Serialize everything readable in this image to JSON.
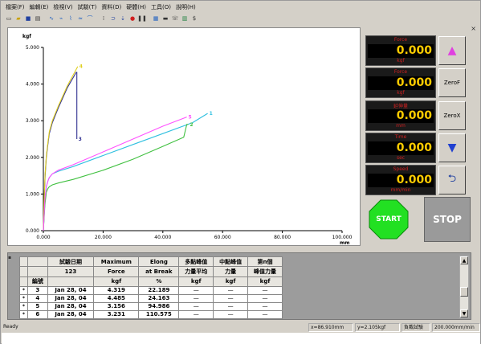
{
  "menu": [
    "檔案(F)",
    "編輯(E)",
    "檢視(V)",
    "試驗(T)",
    "資料(D)",
    "硬體(H)",
    "工具(O)",
    "說明(H)"
  ],
  "toolbar": {
    "icons": [
      "new-icon",
      "open-icon",
      "save-icon",
      "print-icon",
      "sep",
      "curve-icon",
      "chart-icon",
      "chart2-icon",
      "chart3-icon",
      "chart4-icon",
      "sep",
      "cursor-icon",
      "loop-icon",
      "down-icon",
      "stop-icon",
      "pause-icon",
      "sep",
      "table-icon",
      "grid-icon",
      "phone-icon",
      "bars-icon",
      "dollar-icon"
    ]
  },
  "chart_data": {
    "type": "line",
    "title": "",
    "ylabel": "kgf",
    "xlabel": "mm",
    "xlim": [
      0,
      100
    ],
    "ylim": [
      0,
      5
    ],
    "xticks": [
      "0.000",
      "20.000",
      "40.000",
      "60.000",
      "80.000",
      "100.000"
    ],
    "yticks": [
      "0.000",
      "1.000",
      "2.000",
      "3.000",
      "4.000",
      "5.000"
    ],
    "series": [
      {
        "name": "1",
        "color": "#30c0e0",
        "x": [
          0,
          0.5,
          1,
          1.5,
          2,
          3,
          5,
          10,
          20,
          30,
          40,
          50,
          55
        ],
        "y": [
          0,
          0.8,
          1.2,
          1.35,
          1.45,
          1.55,
          1.62,
          1.75,
          2.05,
          2.35,
          2.65,
          2.95,
          3.2
        ]
      },
      {
        "name": "2",
        "color": "#40c040",
        "x": [
          0,
          0.5,
          1,
          1.5,
          2,
          3,
          5,
          10,
          20,
          30,
          40,
          47,
          48,
          48.5
        ],
        "y": [
          0,
          0.7,
          1.05,
          1.15,
          1.2,
          1.25,
          1.3,
          1.4,
          1.65,
          1.95,
          2.3,
          2.55,
          2.9,
          2.9
        ]
      },
      {
        "name": "3",
        "color": "#303090",
        "x": [
          0,
          0.3,
          0.6,
          1,
          1.5,
          2,
          3,
          5,
          8,
          11,
          11.2,
          11.2
        ],
        "y": [
          0,
          0.9,
          1.5,
          2.0,
          2.35,
          2.65,
          2.95,
          3.35,
          3.9,
          4.32,
          4.32,
          2.5
        ]
      },
      {
        "name": "4",
        "color": "#e0d020",
        "x": [
          0,
          0.3,
          0.6,
          1,
          1.5,
          2,
          3,
          5,
          8,
          11.5
        ],
        "y": [
          0,
          0.95,
          1.55,
          2.05,
          2.4,
          2.7,
          3.0,
          3.4,
          3.95,
          4.48
        ]
      },
      {
        "name": "5",
        "color": "#ff50ff",
        "x": [
          0,
          0.5,
          1,
          1.5,
          2,
          3,
          5,
          10,
          20,
          30,
          40,
          48
        ],
        "y": [
          0,
          0.85,
          1.2,
          1.35,
          1.45,
          1.55,
          1.65,
          1.8,
          2.15,
          2.5,
          2.85,
          3.1
        ]
      }
    ]
  },
  "displays": [
    {
      "top_label": "Force",
      "value": "0.000",
      "bottom_label": "kgf"
    },
    {
      "top_label": "Force",
      "value": "0.000",
      "bottom_label": "kgf"
    },
    {
      "top_label": "延伸量",
      "value": "0.000",
      "bottom_label": "mm"
    },
    {
      "top_label": "Time",
      "value": "0.000",
      "bottom_label": "sec"
    },
    {
      "top_label": "Speed",
      "value": "0.000",
      "bottom_label": "mm/min"
    }
  ],
  "side_buttons": {
    "up_arrow": "▲",
    "zero_f": "ZeroF",
    "zero_x": "ZeroX",
    "down_arrow": "▼",
    "return_arrow": "⮌"
  },
  "start_label": "START",
  "stop_label": "STOP",
  "table": {
    "header_row1": [
      "",
      "試驗日期",
      "Maximum",
      "Elong",
      "多點峰值",
      "中點峰值",
      "第n個"
    ],
    "header_row2": [
      "",
      "123",
      "Force",
      "at Break",
      "力量平均",
      "力量",
      "峰值力量"
    ],
    "header_row3": [
      "編號",
      "",
      "kgf",
      "%",
      "kgf",
      "kgf",
      "kgf"
    ],
    "rows": [
      {
        "mark": "*",
        "id": "3",
        "date": "Jan 28, 04",
        "force": "4.319",
        "elong": "22.189",
        "c4": "—",
        "c5": "—",
        "c6": "—"
      },
      {
        "mark": "*",
        "id": "4",
        "date": "Jan 28, 04",
        "force": "4.485",
        "elong": "24.163",
        "c4": "—",
        "c5": "—",
        "c6": "—"
      },
      {
        "mark": "*",
        "id": "5",
        "date": "Jan 28, 04",
        "force": "3.156",
        "elong": "94.986",
        "c4": "—",
        "c5": "—",
        "c6": "—"
      },
      {
        "mark": "*",
        "id": "6",
        "date": "Jan 28, 04",
        "force": "3.231",
        "elong": "110.575",
        "c4": "—",
        "c5": "—",
        "c6": "—"
      }
    ]
  },
  "status": {
    "ready": "Ready",
    "x_readout": "x=86.910mm",
    "y_readout": "y=2.105kgf",
    "mode": "負載試驗",
    "speed": "200.000mm/min"
  }
}
